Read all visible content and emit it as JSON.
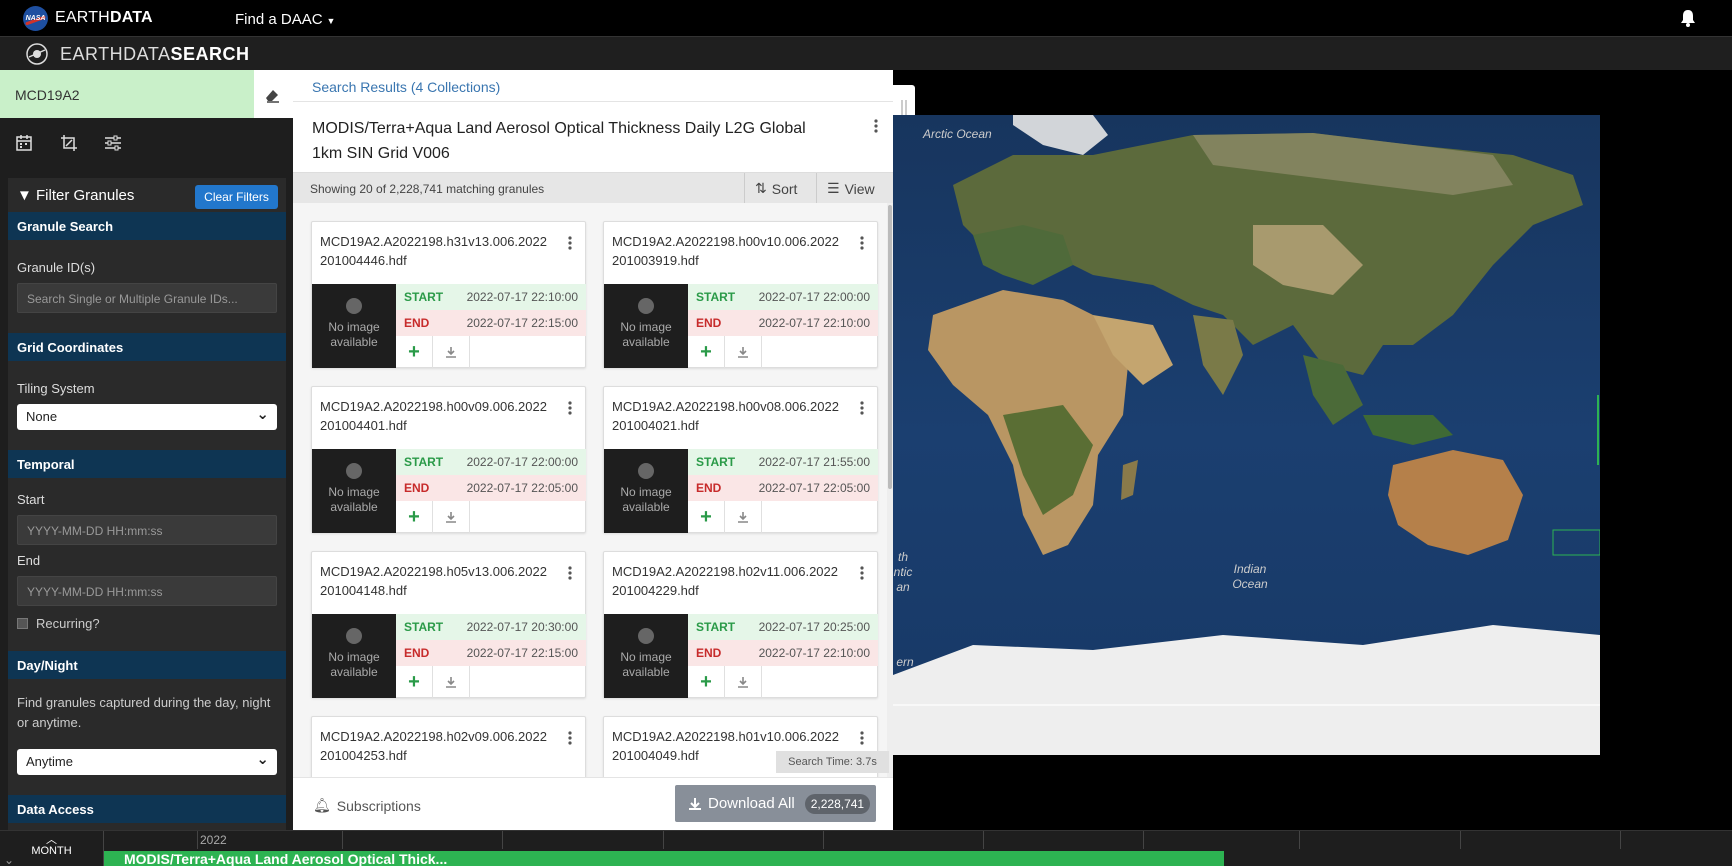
{
  "topbar": {
    "logo_text": "NASA",
    "brand_light": "EARTH",
    "brand_bold": "DATA",
    "find_daac": "Find a DAAC"
  },
  "search_header": {
    "brand_light": "EARTHDATA",
    "brand_bold": "SEARCH"
  },
  "sidebar": {
    "query": "MCD19A2",
    "filter_title": "Filter Granules",
    "clear_filters": "Clear Filters",
    "sections": {
      "granule_search": "Granule Search",
      "granule_ids_label": "Granule ID(s)",
      "granule_ids_placeholder": "Search Single or Multiple Granule IDs...",
      "grid_coordinates": "Grid Coordinates",
      "tiling_label": "Tiling System",
      "tiling_value": "None",
      "temporal": "Temporal",
      "start_label": "Start",
      "start_placeholder": "YYYY-MM-DD HH:mm:ss",
      "end_label": "End",
      "end_placeholder": "YYYY-MM-DD HH:mm:ss",
      "recurring": "Recurring?",
      "day_night": "Day/Night",
      "day_night_help": "Find granules captured during the day, night or anytime.",
      "day_night_value": "Anytime",
      "data_access": "Data Access"
    }
  },
  "results": {
    "crumb": "Search Results (4 Collections)",
    "collection_title": "MODIS/Terra+Aqua Land Aerosol Optical Thickness Daily L2G Global 1km SIN Grid V006",
    "showing": "Showing 20 of 2,228,741 matching granules",
    "sort": "Sort",
    "view": "View",
    "start_label": "START",
    "end_label": "END",
    "no_image": "No image available",
    "granules": [
      {
        "name": "MCD19A2.A2022198.h31v13.006.2022201004446.hdf",
        "start": "2022-07-17 22:10:00",
        "end": "2022-07-17 22:15:00"
      },
      {
        "name": "MCD19A2.A2022198.h00v10.006.2022201003919.hdf",
        "start": "2022-07-17 22:00:00",
        "end": "2022-07-17 22:10:00"
      },
      {
        "name": "MCD19A2.A2022198.h00v09.006.2022201004401.hdf",
        "start": "2022-07-17 22:00:00",
        "end": "2022-07-17 22:05:00"
      },
      {
        "name": "MCD19A2.A2022198.h00v08.006.2022201004021.hdf",
        "start": "2022-07-17 21:55:00",
        "end": "2022-07-17 22:05:00"
      },
      {
        "name": "MCD19A2.A2022198.h05v13.006.2022201004148.hdf",
        "start": "2022-07-17 20:30:00",
        "end": "2022-07-17 22:15:00"
      },
      {
        "name": "MCD19A2.A2022198.h02v11.006.2022201004229.hdf",
        "start": "2022-07-17 20:25:00",
        "end": "2022-07-17 22:10:00"
      },
      {
        "name": "MCD19A2.A2022198.h02v09.006.2022201004253.hdf",
        "start": "",
        "end": ""
      },
      {
        "name": "MCD19A2.A2022198.h01v10.006.2022201004049.hdf",
        "start": "",
        "end": ""
      }
    ],
    "search_time": "Search Time: 3.7s",
    "subscriptions": "Subscriptions",
    "download_all": "Download All",
    "download_count": "2,228,741"
  },
  "map": {
    "labels": {
      "arctic": "Arctic Ocean",
      "indian": "Indian Ocean",
      "atlantic_partial": "th ntic an",
      "southern_partial": "ern"
    }
  },
  "timeline": {
    "zoom": "MONTH",
    "year": "2022",
    "bar_label": "MODIS/Terra+Aqua Land Aerosol Optical Thick..."
  },
  "colors": {
    "accent_blue": "#2277cc",
    "section_header": "#0e3553",
    "query_bg": "#c9f0c9",
    "start_green": "#2a9a48",
    "end_red": "#c72b2b",
    "timeline_bar": "#2db352"
  }
}
